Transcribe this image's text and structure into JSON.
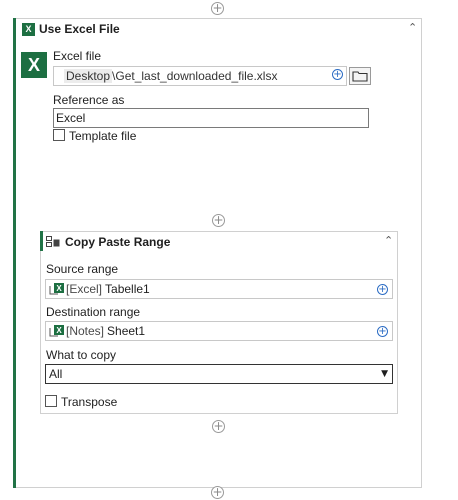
{
  "use_excel_file": {
    "title": "Use Excel File",
    "icon": "excel-icon",
    "excel_file_label": "Excel file",
    "excel_file_prefix": "Desktop",
    "excel_file_value": "\\Get_last_downloaded_file.xlsx",
    "reference_label": "Reference as",
    "reference_value": "Excel",
    "template_label": "Template file",
    "template_checked": false
  },
  "copy_paste_range": {
    "title": "Copy Paste Range",
    "icon": "copy-paste-range-icon",
    "source_label": "Source range",
    "source_prefix": "[Excel]",
    "source_value": "Tabelle1",
    "destination_label": "Destination range",
    "destination_prefix": "[Notes]",
    "destination_value": "Sheet1",
    "what_to_copy_label": "What to copy",
    "what_to_copy_value": "All",
    "transpose_label": "Transpose",
    "transpose_checked": false
  },
  "colors": {
    "accent": "#217346",
    "excel_green": "#1d6f42",
    "plus_blue": "#2b6cc4"
  }
}
